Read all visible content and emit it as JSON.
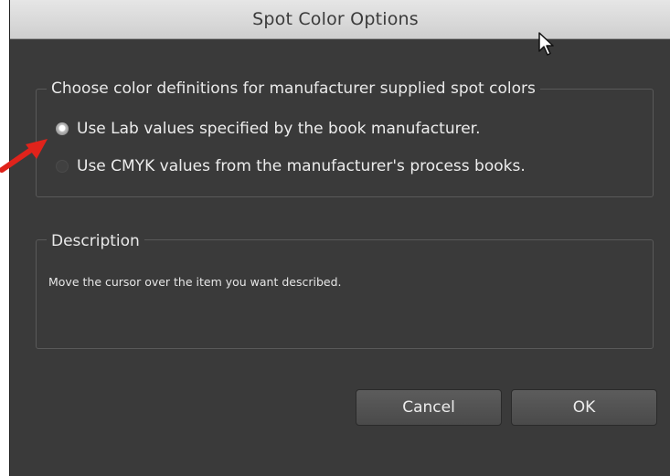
{
  "dialog": {
    "title": "Spot Color Options"
  },
  "color_definitions": {
    "legend": "Choose color definitions for manufacturer supplied spot colors",
    "options": [
      {
        "label": "Use Lab values specified by the book manufacturer.",
        "selected": true
      },
      {
        "label": "Use CMYK values from the manufacturer's process books.",
        "selected": false
      }
    ]
  },
  "description": {
    "legend": "Description",
    "text": "Move the cursor over the item you want described."
  },
  "buttons": {
    "cancel": "Cancel",
    "ok": "OK"
  },
  "colors": {
    "dialog_bg": "#3a3a3a",
    "annotation_arrow": "#e0231b"
  },
  "icons": {
    "cursor": "mouse-pointer-icon",
    "annotation": "red-arrow-icon"
  }
}
